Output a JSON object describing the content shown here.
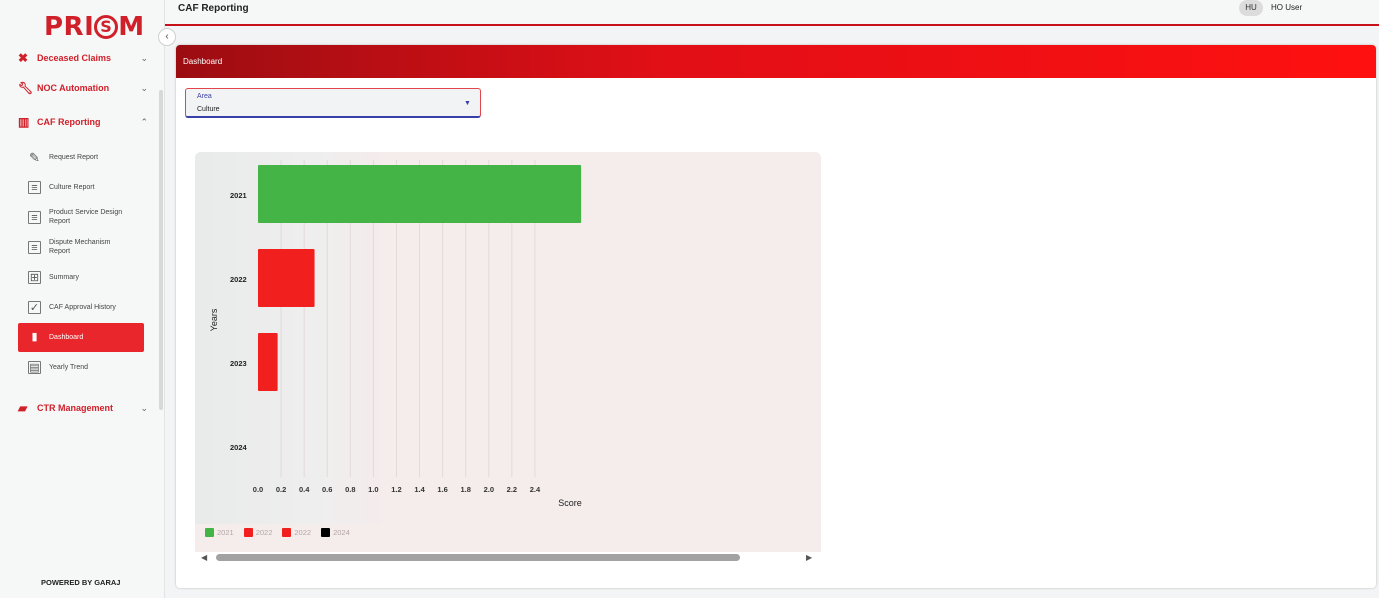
{
  "sidebar": {
    "logo": {
      "prefix": "PRI",
      "mark": "S",
      "suffix": "M"
    },
    "groups": [
      {
        "label": "Deceased Claims",
        "icon": "person-off-icon"
      },
      {
        "label": "NOC Automation",
        "icon": "wrench-icon"
      },
      {
        "label": "CAF Reporting",
        "icon": "bar-chart-icon"
      },
      {
        "label": "CTR Management",
        "icon": "briefcase-icon"
      }
    ],
    "items": [
      {
        "label": "Request Report",
        "icon": "pencil-icon"
      },
      {
        "label": "Culture Report",
        "icon": "list-icon"
      },
      {
        "label": "Product Service Design Report",
        "icon": "list-icon"
      },
      {
        "label": "Dispute Mechanism Report",
        "icon": "list-icon"
      },
      {
        "label": "Summary",
        "icon": "grid-icon"
      },
      {
        "label": "CAF Approval History",
        "icon": "approval-icon"
      },
      {
        "label": "Dashboard",
        "icon": "bar-chart-icon"
      },
      {
        "label": "Yearly Trend",
        "icon": "table-icon"
      }
    ],
    "footer": "POWERED BY GARAJ"
  },
  "header": {
    "title": "CAF Reporting",
    "avatar_initials": "HU",
    "user_name": "HO User"
  },
  "card": {
    "title": "Dashboard",
    "area_filter": {
      "label": "Area",
      "value": "Culture"
    }
  },
  "colors": {
    "accent": "#e8262c",
    "green": "#44b446",
    "red": "#f21f1f"
  },
  "chart_data": {
    "type": "bar",
    "orientation": "horizontal",
    "categories": [
      "2021",
      "2022",
      "2023",
      "2024"
    ],
    "values": [
      2.8,
      0.49,
      0.17,
      0
    ],
    "bar_colors": [
      "#44b446",
      "#f21f1f",
      "#f21f1f",
      null
    ],
    "xlabel": "Score",
    "ylabel": "Years",
    "x_ticks": [
      "0.0",
      "0.2",
      "0.4",
      "0.6",
      "0.8",
      "1.0",
      "1.2",
      "1.4",
      "1.6",
      "1.8",
      "2.0",
      "2.2",
      "2.4"
    ],
    "xlim": [
      0,
      2.4
    ],
    "grid": true,
    "legend_position": "bottom-left",
    "legend": [
      {
        "label": "2021",
        "color": "#44b446"
      },
      {
        "label": "2022",
        "color": "#f21f1f"
      },
      {
        "label": "2022",
        "color": "#f21f1f"
      },
      {
        "label": "2024",
        "color": "#000000"
      }
    ]
  }
}
